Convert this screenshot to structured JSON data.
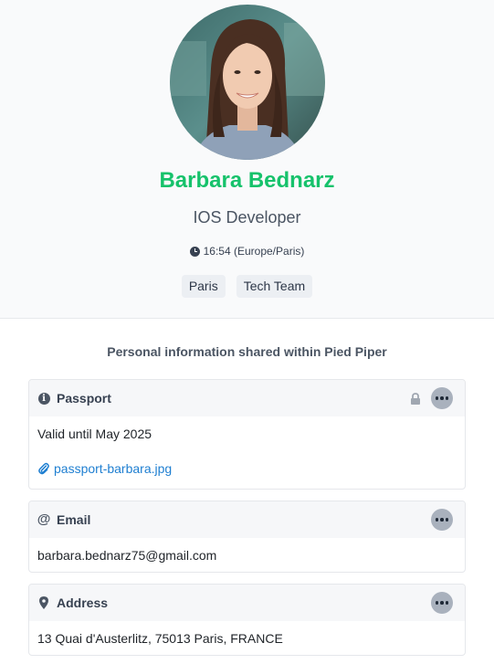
{
  "profile": {
    "name": "Barbara Bednarz",
    "role": "IOS Developer",
    "local_time": "16:54 (Europe/Paris)",
    "tags": [
      "Paris",
      "Tech Team"
    ],
    "name_color": "#16c26b"
  },
  "section": {
    "title": "Personal information shared within Pied Piper"
  },
  "cards": {
    "passport": {
      "title": "Passport",
      "value": "Valid until May 2025",
      "attachment": "passport-barbara.jpg",
      "icon": "info-icon",
      "private": true
    },
    "email": {
      "title": "Email",
      "value": "barbara.bednarz75@gmail.com",
      "icon": "at-icon"
    },
    "address": {
      "title": "Address",
      "value": "13 Quai d'Austerlitz, 75013 Paris, FRANCE",
      "icon": "map-marker-icon"
    }
  }
}
